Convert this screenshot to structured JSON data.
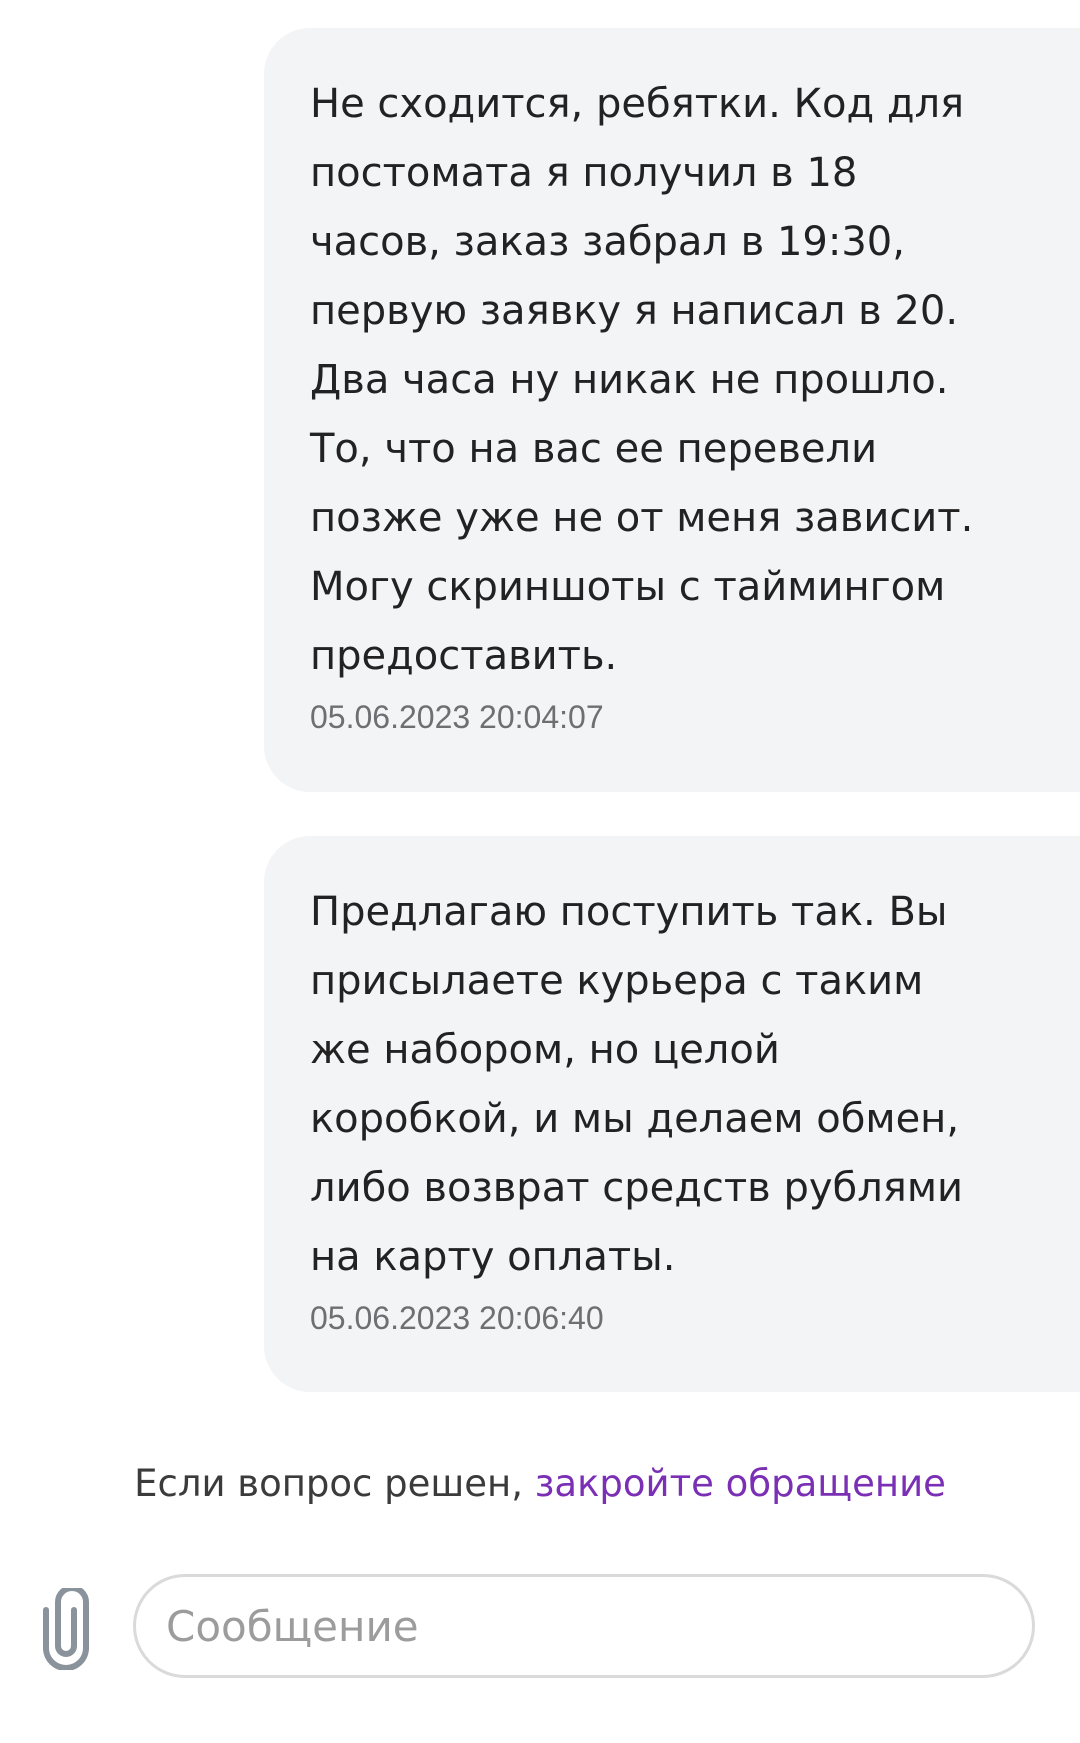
{
  "messages": [
    {
      "text": "Не сходится, ребятки. Код для\nпостомата я получил в 18\nчасов, заказ забрал в 19:30,\nпервую заявку я написал в 20.\nДва часа ну никак не прошло.\nТо, что на вас ее перевели\nпозже уже не от меня зависит.\nМогу скриншоты с таймингом\nпредоставить.",
      "timestamp": "05.06.2023 20:04:07"
    },
    {
      "text": "Предлагаю поступить так. Вы\nприсылаете курьера с таким\nже набором, но целой\nкоробкой, и мы делаем обмен,\nлибо возврат средств рублями\nна карту оплаты.",
      "timestamp": "05.06.2023 20:06:40"
    }
  ],
  "notice": {
    "prefix": "Если вопрос решен, ",
    "link": "закройте обращение"
  },
  "composer": {
    "placeholder": "Сообщение",
    "value": "",
    "attach_icon": "paperclip-icon"
  },
  "colors": {
    "bubble_bg": "#f3f4f6",
    "link": "#7a2fb4",
    "timestamp": "#6e6e73",
    "input_border": "#dadada"
  }
}
